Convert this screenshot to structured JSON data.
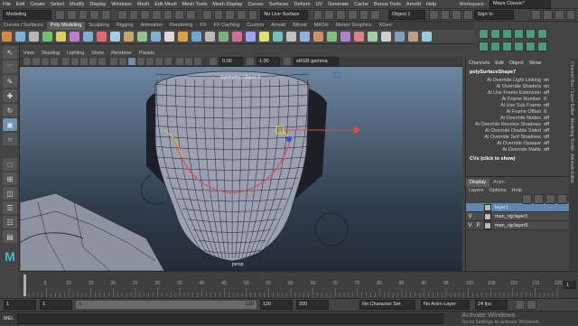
{
  "menubar": {
    "items": [
      "File",
      "Edit",
      "Create",
      "Select",
      "Modify",
      "Display",
      "Windows",
      "Mesh",
      "Edit Mesh",
      "Mesh Tools",
      "Mesh Display",
      "Curves",
      "Surfaces",
      "Deform",
      "UV",
      "Generate",
      "Cache",
      "Bonus Tools",
      "Arnold",
      "Help"
    ],
    "workspace_label": "Workspace :",
    "workspace_value": "Maya Classic*"
  },
  "statusline": {
    "mode": "Modeling",
    "live_surface": "No Live Surface",
    "object_field": "Object 1",
    "sign_in": "Sign In"
  },
  "shelf": {
    "tabs": [
      "Curves / Surfaces",
      "Poly Modeling",
      "Sculpting",
      "Rigging",
      "Animation",
      "Rendering",
      "FX",
      "FX Caching",
      "Custom",
      "Arnold",
      "Bifrost",
      "MASH",
      "Motion Graphics",
      "XGen"
    ],
    "active_tab": "Poly Modeling",
    "icon_colors": [
      "#d88a3a",
      "#7bb0d8",
      "#b6b6b6",
      "#6bc46b",
      "#d7d05a",
      "#c07ad0",
      "#7bb0d8",
      "#e26a6a",
      "#9fd0e8",
      "#c9a56b",
      "#8fc48f",
      "#7bb0d8",
      "#dcdcdc",
      "#e0a040",
      "#6aa8d8",
      "#b9b9b9",
      "#7ab07a",
      "#d86a9a",
      "#a0a0ff",
      "#e0e070",
      "#70c0c0",
      "#c0c0c0",
      "#90b0e0",
      "#d09060",
      "#80c080",
      "#b080d0",
      "#e08080",
      "#a0d0a0",
      "#d0d0d0",
      "#80a0c0",
      "#c0a080",
      "#90d0e0"
    ]
  },
  "viewport": {
    "menu": [
      "View",
      "Shading",
      "Lighting",
      "Show",
      "Renderer",
      "Panels"
    ],
    "fields": {
      "near": "0.00",
      "far": "1.00",
      "color_space": "sRGB gamma"
    },
    "hud_symmetry": "Symmetry: Object X",
    "camera_label": "persp"
  },
  "channelbox": {
    "menu": [
      "Channels",
      "Edit",
      "Object",
      "Show"
    ],
    "node_name": "polySurfaceShape7",
    "attributes": [
      {
        "name": "Ai Override Light Linking",
        "value": "on"
      },
      {
        "name": "Ai Override Shaders",
        "value": "on"
      },
      {
        "name": "Ai Use Frame Extension",
        "value": "off"
      },
      {
        "name": "Ai Frame Number",
        "value": "0"
      },
      {
        "name": "Ai Use Sub Frame",
        "value": "off"
      },
      {
        "name": "Ai Frame Offset",
        "value": "0"
      },
      {
        "name": "Ai Override Nodes",
        "value": "off"
      },
      {
        "name": "Ai Override Receive Shadows",
        "value": "off"
      },
      {
        "name": "Ai Override Double Sided",
        "value": "off"
      },
      {
        "name": "Ai Override Self Shadows",
        "value": "off"
      },
      {
        "name": "Ai Override Opaque",
        "value": "off"
      },
      {
        "name": "Ai Override Matte",
        "value": "off"
      }
    ],
    "cvs_header": "CVs (click to show)"
  },
  "layer_editor": {
    "tabs": [
      "Display",
      "Anim"
    ],
    "menu": [
      "Layers",
      "Options",
      "Help"
    ],
    "layers": [
      {
        "v": "",
        "p": "",
        "name": "layer1",
        "selected": true
      },
      {
        "v": "V",
        "p": "",
        "name": "man_rig:layer1",
        "selected": false
      },
      {
        "v": "V",
        "p": "P",
        "name": "man_rig:layer5",
        "selected": false
      }
    ]
  },
  "side_tabs": [
    "Channel Box / Layer Editor",
    "Modeling Toolkit",
    "Attribute Editor"
  ],
  "timeline": {
    "ticks": [
      "5",
      "10",
      "15",
      "20",
      "25",
      "30",
      "35",
      "40",
      "45",
      "50",
      "55",
      "60",
      "65",
      "70",
      "75",
      "80",
      "85",
      "90",
      "95",
      "100",
      "105",
      "110",
      "115",
      "120"
    ],
    "current_frame": "1"
  },
  "range": {
    "start": "1",
    "inner_start": "1",
    "range_start_label": "1",
    "range_end_label": "120",
    "inner_end": "120",
    "end": "200",
    "character_set": "No Character Set",
    "anim_layer": "No Anim Layer",
    "fps": "24 fps"
  },
  "helpline": {
    "mel_label": "MEL",
    "watermark_1": "Activate Windows",
    "watermark_2": "Go to Settings to activate Windows."
  },
  "colors": {
    "accent": "#5d88b4",
    "selection": "#63b5d6",
    "wire": "#1e1e28",
    "mesh": "#9ba1b0"
  }
}
